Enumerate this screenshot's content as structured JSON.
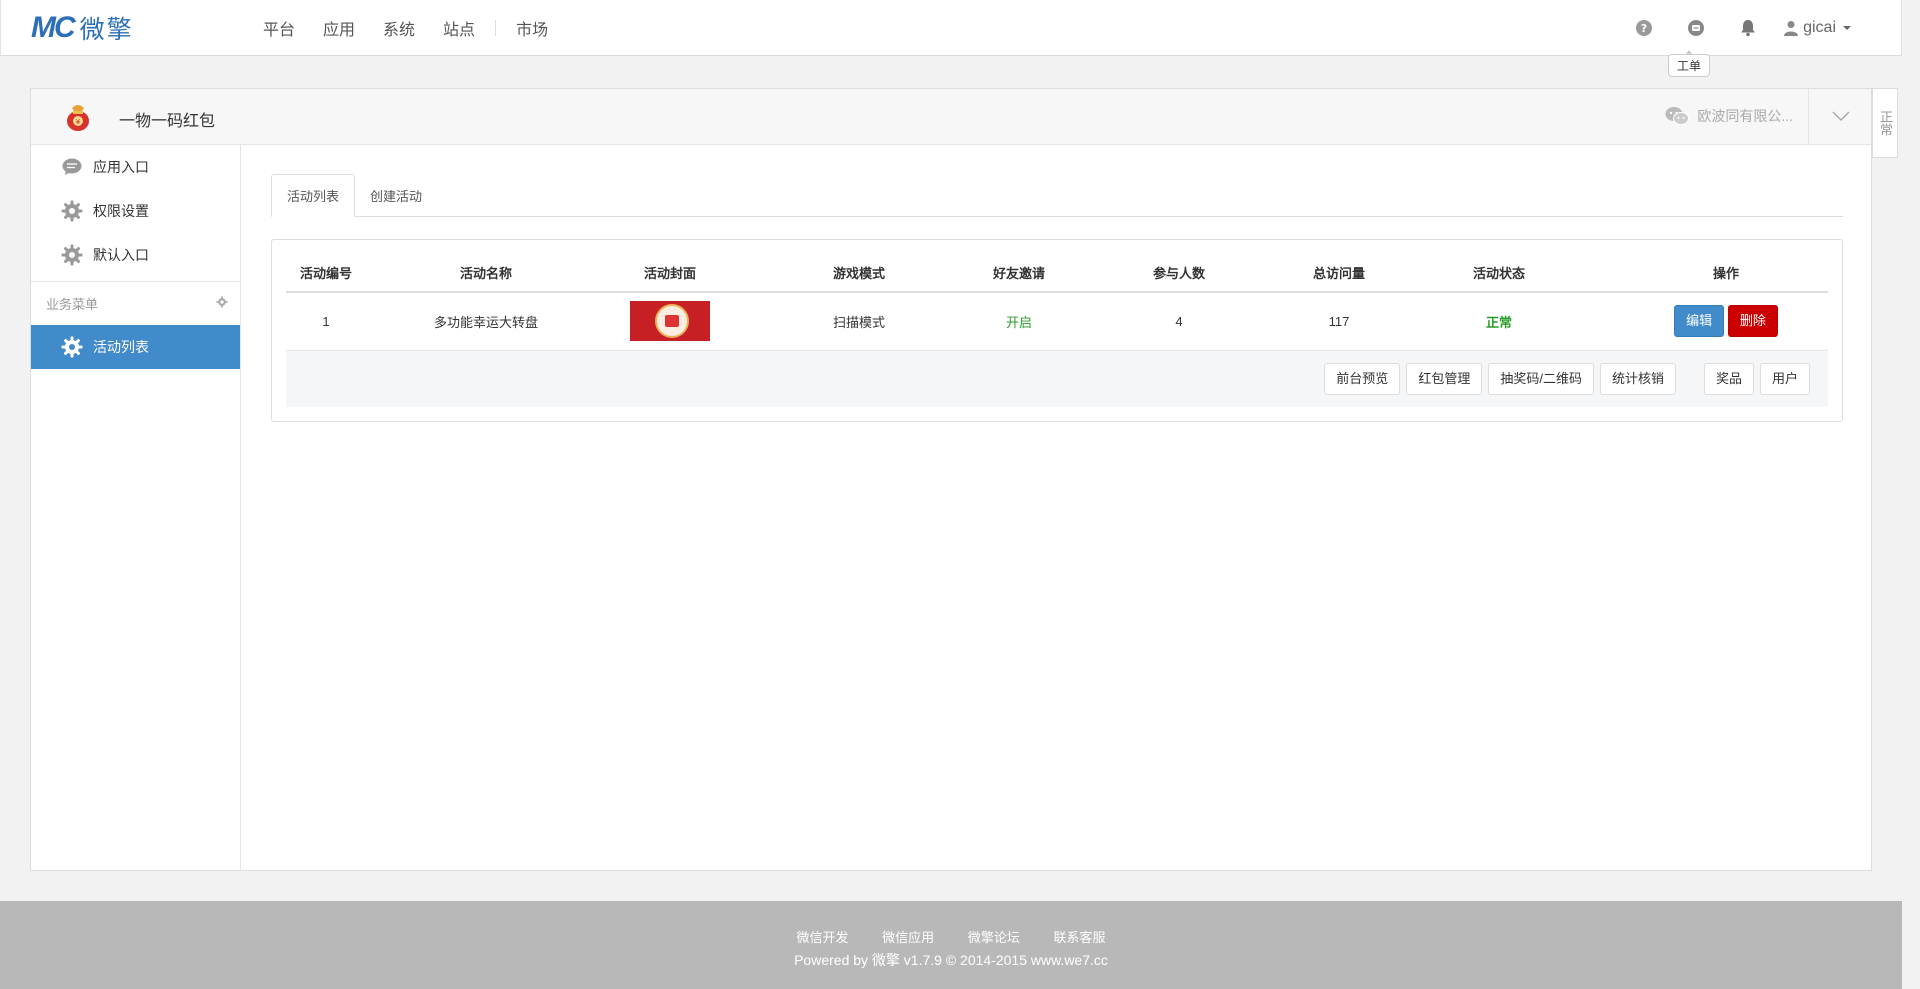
{
  "brand": {
    "mark": "MC",
    "text": "微擎"
  },
  "nav": {
    "items": [
      "平台",
      "应用",
      "系统",
      "站点",
      "市场"
    ]
  },
  "user": {
    "name": "gicai"
  },
  "tooltip": "工单",
  "app": {
    "name": "一物一码红包",
    "account": "欧波同有限公..."
  },
  "side_tab": "正常",
  "sidebar": {
    "items": [
      {
        "label": "应用入口",
        "icon": "chat-icon"
      },
      {
        "label": "权限设置",
        "icon": "gear-icon"
      },
      {
        "label": "默认入口",
        "icon": "gear-icon"
      }
    ],
    "group_label": "业务菜单",
    "active_label": "活动列表"
  },
  "tabs": [
    "活动列表",
    "创建活动"
  ],
  "table": {
    "headers": [
      "活动编号",
      "活动名称",
      "活动封面",
      "游戏模式",
      "好友邀请",
      "参与人数",
      "总访问量",
      "活动状态",
      "操作"
    ],
    "row": {
      "id": "1",
      "name": "多功能幸运大转盘",
      "mode": "扫描模式",
      "invite": "开启",
      "participants": "4",
      "visits": "117",
      "status": "正常",
      "edit": "编辑",
      "delete": "删除"
    },
    "actions": [
      "前台预览",
      "红包管理",
      "抽奖码/二维码",
      "统计核销"
    ],
    "actions2": [
      "奖品",
      "用户"
    ]
  },
  "footer": {
    "links": [
      "微信开发",
      "微信应用",
      "微擎论坛",
      "联系客服"
    ],
    "copyright": "Powered by 微擎 v1.7.9 © 2014-2015 www.we7.cc"
  },
  "colors": {
    "primary": "#428bca",
    "danger": "#cc0000",
    "success": "#2a9c2a"
  }
}
